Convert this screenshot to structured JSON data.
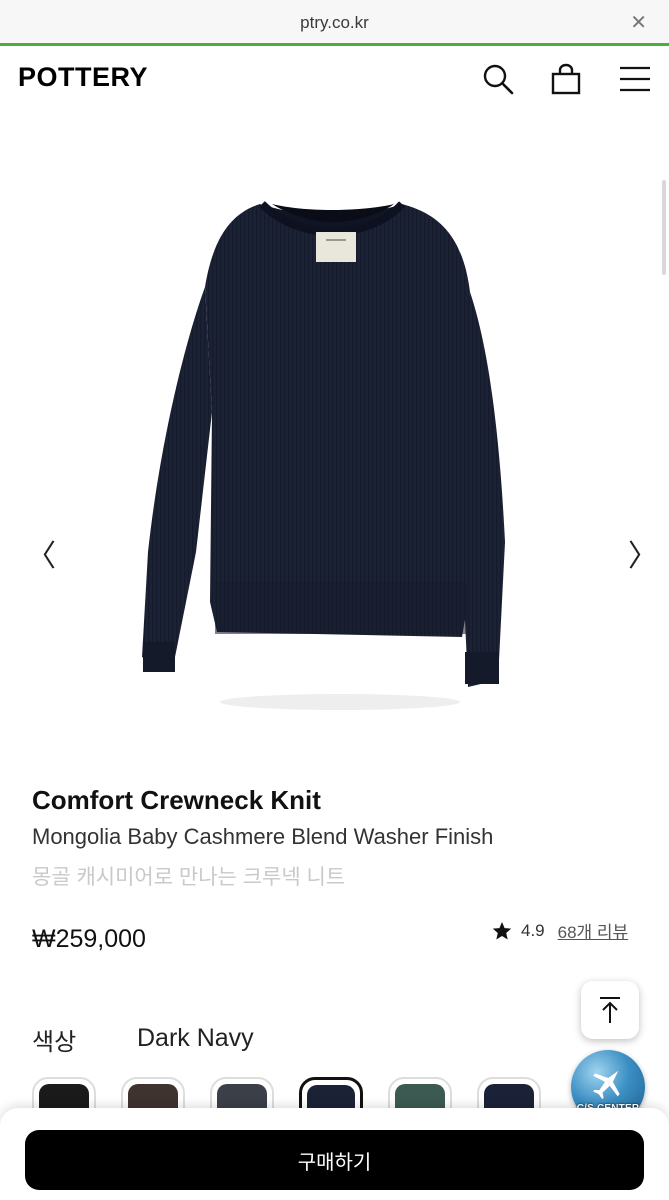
{
  "browser": {
    "url": "ptry.co.kr",
    "close_glyph": "✕"
  },
  "header": {
    "logo": "POTTERY",
    "icons": [
      "search-icon",
      "shopping-bag-icon",
      "hamburger-menu-icon"
    ]
  },
  "gallery": {
    "prev_glyph": "〈",
    "next_glyph": "〉",
    "sweater_color": "#1c2236"
  },
  "product": {
    "title": "Comfort Crewneck Knit",
    "subtitle": "Mongolia Baby Cashmere Blend Washer Finish",
    "korean_desc": "몽골 캐시미어로 만나는 크루넥 니트",
    "price": "₩259,000",
    "rating": "4.9",
    "reviews": "68개 리뷰"
  },
  "color": {
    "label": "색상",
    "selected": "Dark Navy",
    "swatches": [
      {
        "color": "#1a1a1a",
        "selected": false
      },
      {
        "color": "#3f3330",
        "selected": false
      },
      {
        "color": "#3a3f48",
        "selected": false
      },
      {
        "color": "#1c2236",
        "selected": true
      },
      {
        "color": "#3d5a52",
        "selected": false
      },
      {
        "color": "#1b2238",
        "selected": false
      }
    ]
  },
  "widgets": {
    "to_top_icon": "arrow-up-to-top-icon",
    "cs_label": "C/S CENTER"
  },
  "cta": {
    "buy_label": "구매하기"
  }
}
